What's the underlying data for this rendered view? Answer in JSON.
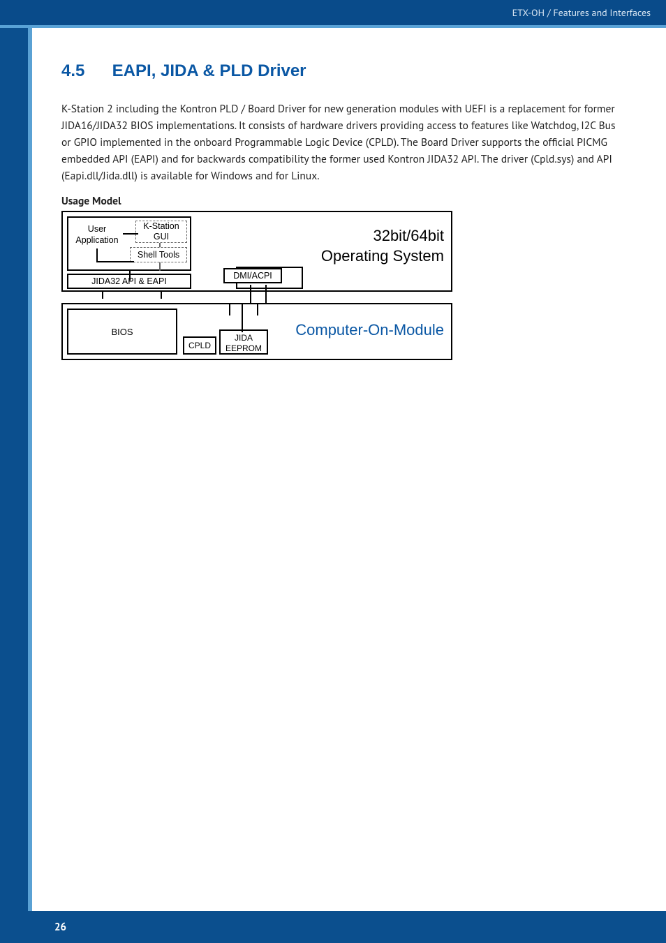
{
  "header": {
    "breadcrumb": "ETX-OH / Features and Interfaces"
  },
  "section": {
    "number": "4.5",
    "title": "EAPI, JIDA & PLD Driver",
    "paragraph": "K-Station 2 including the Kontron PLD / Board Driver for new generation modules with UEFI is a replacement for former JIDA16/JIDA32 BIOS implementations. It consists of hardware drivers providing access to features like Watchdog, I2C Bus or GPIO implemented in the onboard Programmable Logic Device (CPLD). The Board Driver supports the official PICMG embedded API (EAPI) and for backwards compatibility the former used Kontron JIDA32 API. The driver (Cpld.sys) and API (Eapi.dll/Jida.dll) is available for Windows and for Linux.",
    "subhead": "Usage Model"
  },
  "diagram": {
    "user_app": "User Application",
    "kstation": "K-Station GUI",
    "shell_tools": "Shell Tools",
    "api_row": "JIDA32 API & EAPI",
    "dmi": "DMI/ACPI",
    "os_line1": "32bit/64bit",
    "os_line2": "Operating System",
    "bios": "BIOS",
    "cpld": "CPLD",
    "jida_eeprom": "JIDA EEPROM",
    "com": "Computer-On-Module"
  },
  "footer": {
    "page": "26"
  }
}
